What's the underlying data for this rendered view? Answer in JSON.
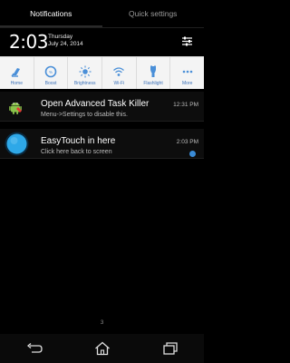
{
  "tabs": [
    {
      "label": "Notifications",
      "active": true
    },
    {
      "label": "Quick settings",
      "active": false
    }
  ],
  "clock": {
    "time": "2:03",
    "day": "Thursday",
    "date": "July 24, 2014"
  },
  "header_actions": {
    "settings_icon": "settings-sliders-icon"
  },
  "quick_settings": [
    {
      "label": "Home",
      "icon": "home-brush-icon"
    },
    {
      "label": "Boost",
      "icon": "boost-gauge-icon"
    },
    {
      "label": "Brightness",
      "icon": "brightness-sun-icon"
    },
    {
      "label": "Wi-Fi",
      "icon": "wifi-icon"
    },
    {
      "label": "Flashlight",
      "icon": "flashlight-icon"
    },
    {
      "label": "More",
      "icon": "more-dots-icon"
    }
  ],
  "notifications": [
    {
      "title": "Open Advanced Task Killer",
      "subtitle": "Menu->Settings to disable this.",
      "time": "12:31 PM",
      "icon": "android-robot-icon"
    },
    {
      "title": "EasyTouch in here",
      "subtitle": "Click here back to screen",
      "time": "2:03 PM",
      "icon": "easytouch-ball-icon"
    }
  ],
  "notification_count": "3",
  "navbar": [
    {
      "icon": "back-icon"
    },
    {
      "icon": "home-icon"
    },
    {
      "icon": "recent-apps-icon"
    }
  ],
  "colors": {
    "background": "#000000",
    "quick_settings_bg": "#f4f4f4",
    "accent_blue": "#3a8bd6",
    "easytouch_blue": "#2ea8e8"
  }
}
